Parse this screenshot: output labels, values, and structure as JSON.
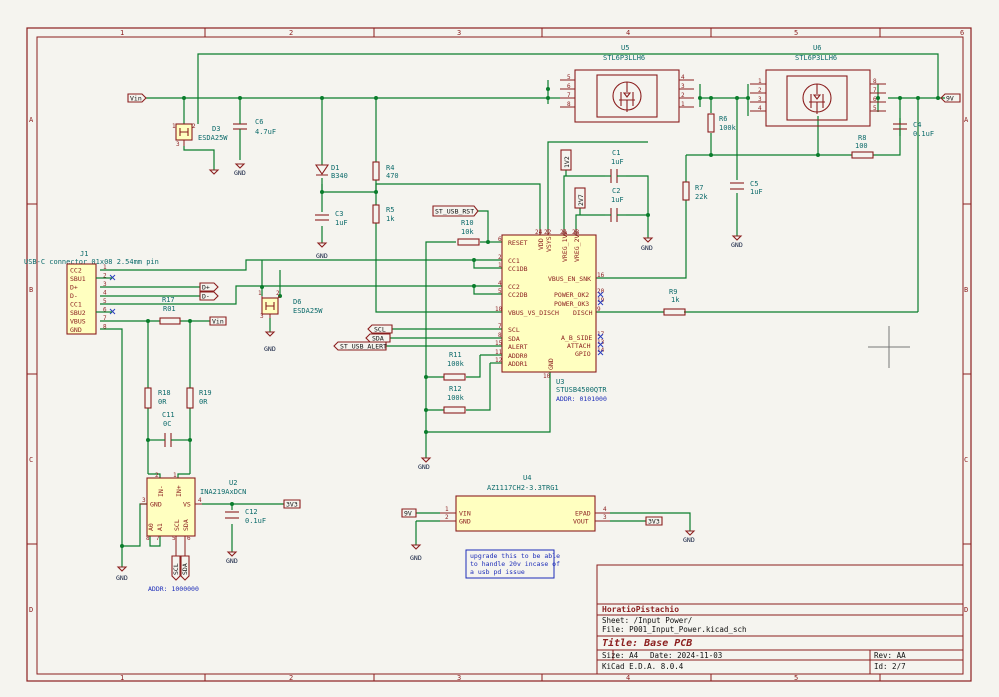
{
  "frame": {
    "columns": [
      "1",
      "2",
      "3",
      "4",
      "5",
      "6"
    ],
    "rows": [
      "A",
      "B",
      "C",
      "D"
    ]
  },
  "components": {
    "U5": {
      "ref": "U5",
      "value": "STL6P3LLH6",
      "pins": [
        "5",
        "6",
        "7",
        "8",
        "4",
        "3",
        "2",
        "1"
      ]
    },
    "U6": {
      "ref": "U6",
      "value": "STL6P3LLH6",
      "pins": [
        "1",
        "2",
        "3",
        "4",
        "8",
        "7",
        "6",
        "5"
      ]
    },
    "D3": {
      "ref": "D3",
      "value": "ESDA25W",
      "pins": [
        "1",
        "2",
        "3"
      ]
    },
    "C6": {
      "ref": "C6",
      "value": "4.7uF"
    },
    "D1": {
      "ref": "D1",
      "value": "B340"
    },
    "R4": {
      "ref": "R4",
      "value": "470"
    },
    "C3": {
      "ref": "C3",
      "value": "1uF"
    },
    "R5": {
      "ref": "R5",
      "value": "1k"
    },
    "R6": {
      "ref": "R6",
      "value": "100k"
    },
    "C5": {
      "ref": "C5",
      "value": "1uF"
    },
    "R7": {
      "ref": "R7",
      "value": "22k"
    },
    "R8": {
      "ref": "R8",
      "value": "100"
    },
    "C4": {
      "ref": "C4",
      "value": "0.1uF"
    },
    "C1": {
      "ref": "C1",
      "value": "1uF"
    },
    "C2": {
      "ref": "C2",
      "value": "1uF"
    },
    "R10": {
      "ref": "R10",
      "value": "10k"
    },
    "R11": {
      "ref": "R11",
      "value": "100k"
    },
    "R12": {
      "ref": "R12",
      "value": "100k"
    },
    "R9": {
      "ref": "R9",
      "value": "1k"
    },
    "R17": {
      "ref": "R17"
    },
    "R01": {
      "ref": "R01"
    },
    "R18": {
      "ref": "R18",
      "value": "0R"
    },
    "R19": {
      "ref": "R19",
      "value": "0R"
    },
    "C11": {
      "ref": "C11",
      "value": "0C"
    },
    "C12": {
      "ref": "C12",
      "value": "0.1uF"
    },
    "D6": {
      "ref": "D6",
      "value": "ESDA25W",
      "pins": [
        "1",
        "2",
        "3"
      ]
    },
    "J1": {
      "ref": "J1",
      "value": "USB-C connector 01x08 2.54mm pin",
      "pins": [
        {
          "num": "1",
          "name": "CC2"
        },
        {
          "num": "2",
          "name": "SBU1"
        },
        {
          "num": "3",
          "name": "D+"
        },
        {
          "num": "4",
          "name": "D-"
        },
        {
          "num": "5",
          "name": "CC1"
        },
        {
          "num": "6",
          "name": "SBU2"
        },
        {
          "num": "7",
          "name": "VBUS"
        },
        {
          "num": "8",
          "name": "GND"
        }
      ]
    },
    "U3": {
      "ref": "U3",
      "value": "STUSB4500QTR",
      "addr": "ADDR: 0101000",
      "top_pins": [
        {
          "num": "24",
          "name": "VDD"
        },
        {
          "num": "22",
          "name": "VSYS"
        },
        {
          "num": "21",
          "name": "VREG_1V2"
        },
        {
          "num": "23",
          "name": "VREG_2V7"
        }
      ],
      "left_pins": [
        {
          "num": "6",
          "name": "RESET"
        },
        {
          "num": "2",
          "name": "CC1"
        },
        {
          "num": "1",
          "name": "CC1DB"
        },
        {
          "num": "4",
          "name": "CC2"
        },
        {
          "num": "5",
          "name": "CC2DB"
        },
        {
          "num": "18",
          "name": "VBUS_VS_DISCH"
        },
        {
          "num": "7",
          "name": "SCL"
        },
        {
          "num": "8",
          "name": "SDA"
        },
        {
          "num": "15",
          "name": "ALERT"
        },
        {
          "num": "11",
          "name": "ADDR0"
        },
        {
          "num": "12",
          "name": "ADDR1"
        }
      ],
      "right_pins": [
        {
          "num": "16",
          "name": "VBUS_EN_SNK"
        },
        {
          "num": "20",
          "name": "POWER_OK2"
        },
        {
          "num": "19",
          "name": "POWER_OK3"
        },
        {
          "num": "9",
          "name": "DISCH"
        },
        {
          "num": "17",
          "name": "A_B_SIDE"
        },
        {
          "num": "13",
          "name": "ATTACH"
        },
        {
          "num": "14",
          "name": "GPIO"
        }
      ],
      "bottom_pins": [
        {
          "num": "3",
          "name": "GND"
        },
        {
          "num": "10",
          "name": "GND"
        }
      ]
    },
    "U2": {
      "ref": "U2",
      "value": "INA219AxDCN",
      "addr": "ADDR: 1000000",
      "pins": [
        {
          "num": "1",
          "name": "IN+"
        },
        {
          "num": "2",
          "name": "IN-"
        },
        {
          "num": "3",
          "name": "GND"
        },
        {
          "num": "4",
          "name": "VS"
        },
        {
          "num": "5",
          "name": "SCL"
        },
        {
          "num": "6",
          "name": "SDA"
        },
        {
          "num": "7",
          "name": "A1"
        },
        {
          "num": "8",
          "name": "A0"
        }
      ]
    },
    "U4": {
      "ref": "U4",
      "value": "AZ1117CH2-3.3TRG1",
      "pins": [
        {
          "num": "1",
          "name": "VIN"
        },
        {
          "num": "2",
          "name": "GND"
        },
        {
          "num": "4",
          "name": "EPAD"
        },
        {
          "num": "3",
          "name": "VOUT"
        }
      ]
    }
  },
  "labels": {
    "vin": "Vin",
    "v9": "9V",
    "v3v3": "3V3",
    "v1v2": "1V2",
    "v2v7": "2V7",
    "gnd": "GND",
    "st_usb_rst": "ST_USB_RST",
    "scl": "SCL",
    "sda": "SDA",
    "st_usb_alert": "ST_USB_ALERT",
    "dp": "D+",
    "dm": "D-"
  },
  "note": [
    "upgrade this to be able",
    "to handle 20v incase of",
    "a usb pd issue"
  ],
  "title_block": {
    "author": "HoratioPistachio",
    "sheet": "Sheet: /Input Power/",
    "file": "File: P001_Input_Power.kicad_sch",
    "title": "Title: Base PCB",
    "size": "Size: A4",
    "date": "Date: 2024-11-03",
    "rev": "Rev: AA",
    "tool": "KiCad E.D.A. 8.0.4",
    "id": "Id: 2/7"
  }
}
